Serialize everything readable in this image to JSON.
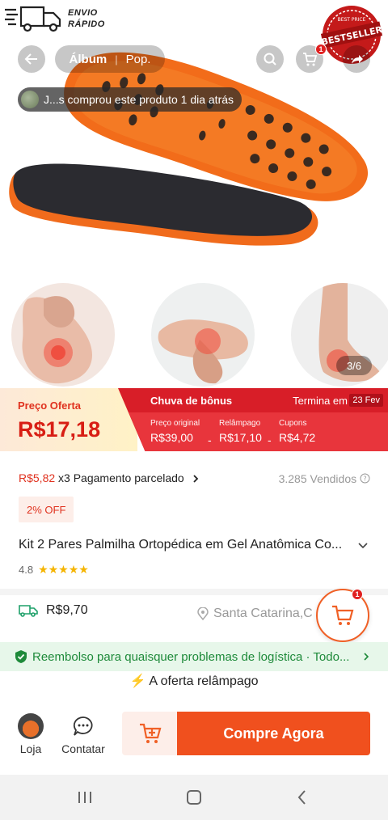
{
  "brand": {
    "shipping_line1": "ENVIO",
    "shipping_line2": "RÁPIDO",
    "bestseller": "BESTSELLER",
    "best_price": "BEST PRICE"
  },
  "top_nav": {
    "tab_album": "Álbum",
    "tab_pop": "Pop.",
    "cart_count": "1"
  },
  "purchase_notice": "J...s comprou este produto 1 dia atrás",
  "gallery": {
    "counter": "3/6"
  },
  "offer": {
    "label": "Preço Oferta",
    "price": "R$17,18",
    "bonus_title": "Chuva de bônus",
    "ends_label": "Termina em",
    "ends_date": "23 Fev",
    "breakdown": [
      {
        "key": "Preço original",
        "value": "R$39,00"
      },
      {
        "key": "Relâmpago",
        "value": "R$17,10"
      },
      {
        "key": "Cupons",
        "value": "R$4,72"
      }
    ],
    "op1": "-",
    "op2": "-"
  },
  "installments": {
    "amount": "R$5,82",
    "text": " x3 Pagamento parcelado"
  },
  "sold": "3.285 Vendidos",
  "discount_tag": "2% OFF",
  "product": {
    "title": "Kit 2 Pares Palmilha Ortopédica em Gel Anatômica Co...",
    "rating": "4.8",
    "stars": 4.8
  },
  "shipping": {
    "price": "R$9,70",
    "location": "Santa Catarina,C"
  },
  "floating_cart_count": "1",
  "refund_banner": "Reembolso para quaisquer problemas de logística · Todo...",
  "flash_offer": "A oferta relâmpago",
  "bottom_bar": {
    "store": "Loja",
    "contact": "Contatar",
    "buy_now": "Compre Agora"
  },
  "colors": {
    "primary": "#f0501e",
    "offer_red": "#d81e28",
    "success": "#1e8a3a",
    "star": "#f5b400"
  }
}
